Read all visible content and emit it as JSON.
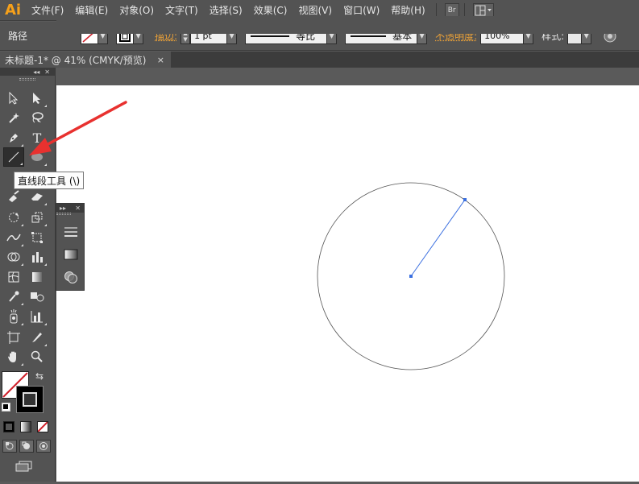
{
  "app": {
    "logo": "Ai",
    "accent": "#f7a11a"
  },
  "menu": [
    "文件(F)",
    "编辑(E)",
    "对象(O)",
    "文字(T)",
    "选择(S)",
    "效果(C)",
    "视图(V)",
    "窗口(W)",
    "帮助(H)"
  ],
  "menu_buttons": {
    "bridge": "Br"
  },
  "control": {
    "object_type": "路径",
    "stroke_label": "描边:",
    "stroke_weight": "1 pt",
    "profile_label": "等比",
    "brush_label": "基本",
    "opacity_label": "不透明度:",
    "opacity_value": "100%",
    "style_label": "样式:"
  },
  "document": {
    "tab_title": "未标题-1* @ 41% (CMYK/预览)",
    "close_glyph": "×"
  },
  "tooltip": {
    "text": "直线段工具 (\\)"
  },
  "tools": [
    "selection-tool",
    "direct-selection-tool",
    "magic-wand-tool",
    "lasso-tool",
    "pen-tool",
    "type-tool",
    "line-segment-tool",
    "ellipse-tool",
    "paintbrush-tool",
    "eraser-tool",
    "rotate-tool",
    "scale-tool",
    "warp-tool",
    "free-transform-tool",
    "symbol-sprayer-tool",
    "graph-tool",
    "mesh-tool",
    "gradient-tool",
    "eyedropper-tool",
    "blend-tool",
    "symbol-tool",
    "column-graph-tool",
    "artboard-tool",
    "slice-tool",
    "hand-tool",
    "zoom-tool"
  ],
  "colors": {
    "path_line": "#3a6fe0",
    "circle_stroke": "#555555",
    "arrow": "#e8312f"
  }
}
